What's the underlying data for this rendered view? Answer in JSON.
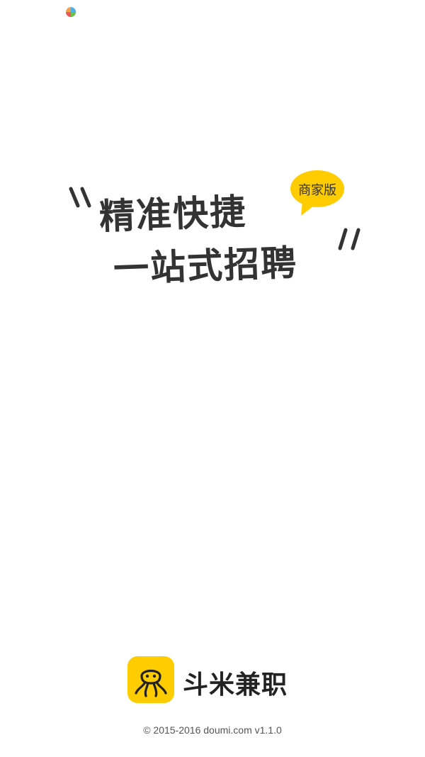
{
  "slogan": {
    "line1": "精准快捷",
    "line2": "一站式招聘",
    "badge": "商家版"
  },
  "brand": {
    "name": "斗米兼职",
    "logo_icon": "octopus-icon",
    "accent_color": "#FFCC00"
  },
  "footer": {
    "copyright": "© 2015-2016 doumi.com v1.1.0"
  }
}
